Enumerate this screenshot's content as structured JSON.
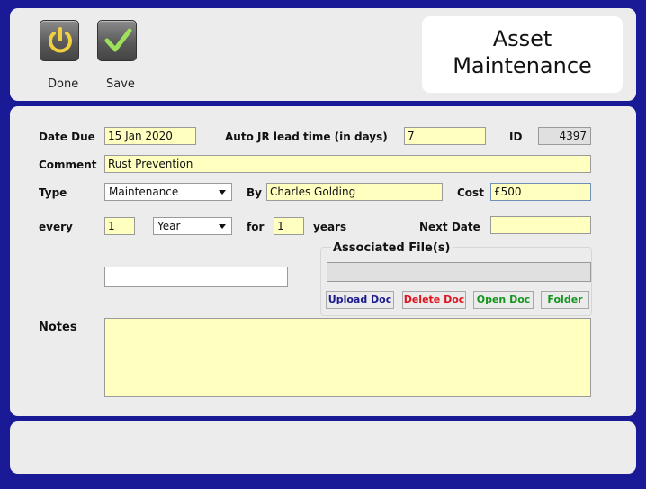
{
  "toolbar": {
    "done_label": "Done",
    "save_label": "Save"
  },
  "title": {
    "line1": "Asset",
    "line2": "Maintenance"
  },
  "form": {
    "date_due_label": "Date Due",
    "date_due_value": "15 Jan 2020",
    "lead_time_label": "Auto JR lead time (in days)",
    "lead_time_value": "7",
    "id_label": "ID",
    "id_value": "4397",
    "comment_label": "Comment",
    "comment_value": "Rust Prevention",
    "type_label": "Type",
    "type_value": "Maintenance",
    "by_label": "By",
    "by_value": "Charles Golding",
    "cost_label": "Cost",
    "cost_value": "£500",
    "every_label": "every",
    "every_value": "1",
    "period_value": "Year",
    "for_label": "for",
    "for_value": "1",
    "years_label": "years",
    "next_date_label": "Next Date",
    "next_date_value": "",
    "extra_field_value": "",
    "notes_label": "Notes",
    "notes_value": ""
  },
  "files": {
    "group_label": "Associated File(s)",
    "file_path_value": "",
    "upload_label": "Upload Doc",
    "delete_label": "Delete Doc",
    "open_label": "Open Doc",
    "folder_label": "Folder"
  },
  "colors": {
    "frame": "#1a1a96",
    "field_fill": "#ffffc0",
    "upload": "#1a1a8c",
    "delete": "#e0141e",
    "open": "#14961e",
    "folder": "#14961e"
  }
}
